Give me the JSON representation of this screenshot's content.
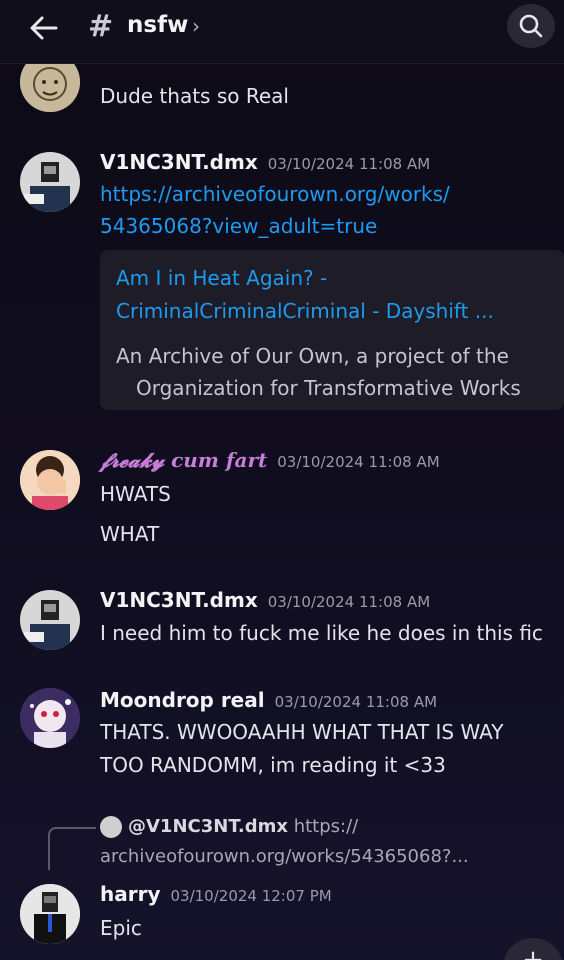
{
  "header": {
    "channel_name": "nsfw",
    "hash_symbol": "#",
    "chevron": "›"
  },
  "messages": [
    {
      "id": "m0",
      "text": "Dude thats so Real"
    },
    {
      "id": "m1",
      "author": "V1NC3NT.dmx",
      "timestamp": "03/10/2024 11:08 AM",
      "link_line1": "https://archiveofourown.org/works/",
      "link_line2": "54365068?view_adult=true",
      "embed": {
        "title_line1": "Am I in Heat Again? -",
        "title_line2": "CriminalCriminalCriminal - Dayshift ...",
        "desc_line1": "An Archive of Our Own, a project of the",
        "desc_line2": "Organization for Transformative Works"
      }
    },
    {
      "id": "m2",
      "author": "𝓯𝓻𝓮𝓪𝓴𝔂 cum fart",
      "author_color": "#c77dd9",
      "timestamp": "03/10/2024 11:08 AM",
      "line1": "HWATS",
      "line2": "WHAT"
    },
    {
      "id": "m3",
      "author": "V1NC3NT.dmx",
      "timestamp": "03/10/2024 11:08 AM",
      "line1": "I need him to fuck me like he does in this fic"
    },
    {
      "id": "m4",
      "author": "Moondrop real",
      "timestamp": "03/10/2024 11:08 AM",
      "line1": "THATS. WWOOAAHH WHAT THAT IS WAY",
      "line2": "TOO RANDOMM, im reading it <33"
    },
    {
      "id": "m5",
      "author": "harry",
      "timestamp": "03/10/2024 12:07 PM",
      "line1": "Epic",
      "reply": {
        "author": "@V1NC3NT.dmx",
        "text_line1": "https://",
        "text_line2": "archiveofourown.org/works/54365068?..."
      }
    }
  ],
  "fab_label": "+",
  "colors": {
    "link": "#1e9bf0",
    "background": "#0f0c1c"
  }
}
